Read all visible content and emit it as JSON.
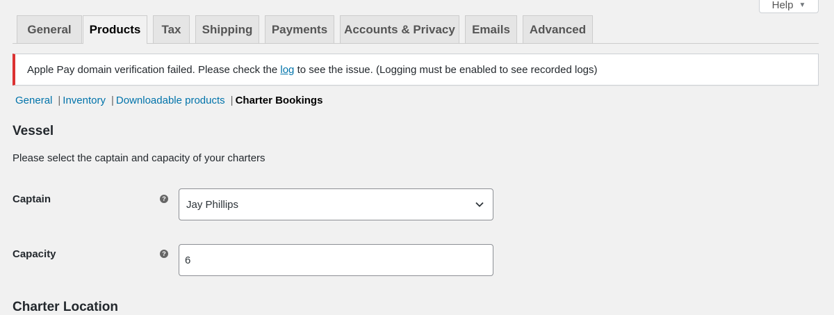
{
  "help": {
    "label": "Help",
    "caret": "▼"
  },
  "tabs": [
    {
      "label": "General"
    },
    {
      "label": "Products",
      "active": true
    },
    {
      "label": "Tax"
    },
    {
      "label": "Shipping"
    },
    {
      "label": "Payments"
    },
    {
      "label": "Accounts & Privacy"
    },
    {
      "label": "Emails"
    },
    {
      "label": "Advanced"
    }
  ],
  "notice": {
    "text_before": "Apple Pay domain verification failed. Please check the ",
    "link_text": "log",
    "text_after": " to see the issue. (Logging must be enabled to see recorded logs)",
    "border_color": "#dc3232"
  },
  "subnav": {
    "items": [
      "General",
      "Inventory",
      "Downloadable products"
    ],
    "separator": "|",
    "current": "Charter Bookings"
  },
  "section": {
    "title": "Vessel",
    "description": "Please select the captain and capacity of your charters"
  },
  "fields": {
    "captain": {
      "label": "Captain",
      "value": "Jay Phillips",
      "help_icon": "question-circle-icon"
    },
    "capacity": {
      "label": "Capacity",
      "value": "6",
      "help_icon": "question-circle-icon"
    }
  },
  "next_section": {
    "title": "Charter Location"
  },
  "colors": {
    "accent": "#0073aa",
    "error": "#dc3232",
    "background": "#f1f1f1"
  }
}
